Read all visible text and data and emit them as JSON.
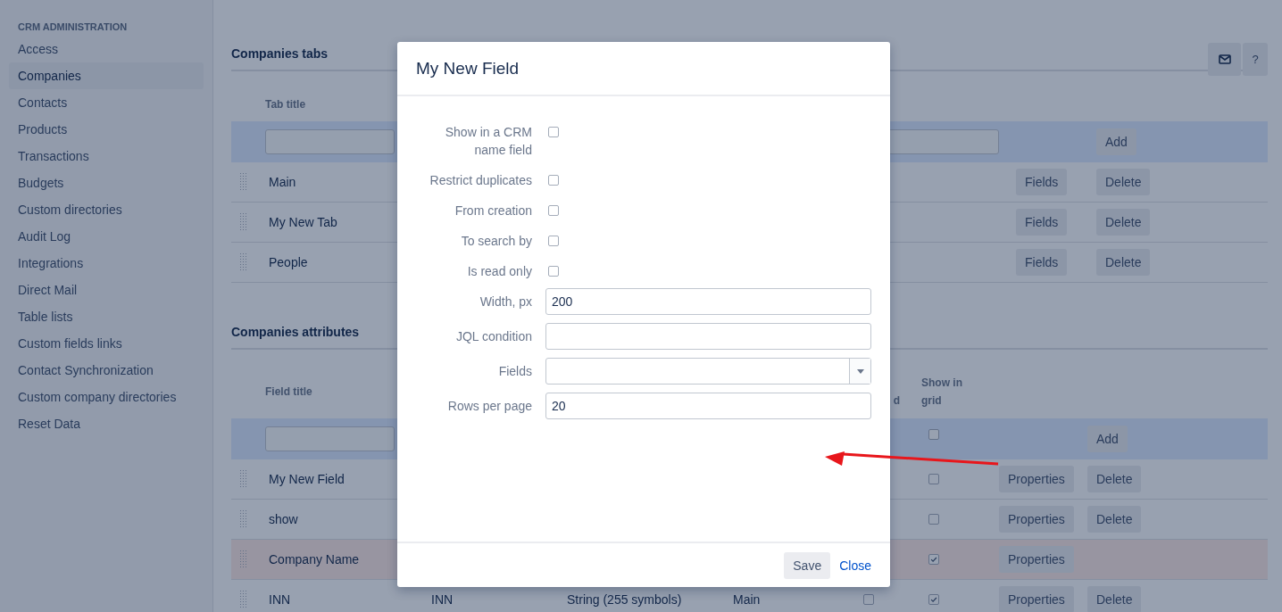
{
  "sidebar": {
    "heading": "CRM ADMINISTRATION",
    "items": [
      {
        "label": "Access",
        "selected": false
      },
      {
        "label": "Companies",
        "selected": true
      },
      {
        "label": "Contacts",
        "selected": false
      },
      {
        "label": "Products",
        "selected": false
      },
      {
        "label": "Transactions",
        "selected": false
      },
      {
        "label": "Budgets",
        "selected": false
      },
      {
        "label": "Custom directories",
        "selected": false
      },
      {
        "label": "Audit Log",
        "selected": false
      },
      {
        "label": "Integrations",
        "selected": false
      },
      {
        "label": "Direct Mail",
        "selected": false
      },
      {
        "label": "Table lists",
        "selected": false
      },
      {
        "label": "Custom fields links",
        "selected": false
      },
      {
        "label": "Contact Synchronization",
        "selected": false
      },
      {
        "label": "Custom company directories",
        "selected": false
      },
      {
        "label": "Reset Data",
        "selected": false
      }
    ]
  },
  "header_buttons": [
    {
      "kind": "mail"
    },
    {
      "kind": "text",
      "label": "?"
    }
  ],
  "tabs_section": {
    "title": "Companies tabs",
    "columns": [
      "Tab title"
    ],
    "add_button": "Add",
    "rows": [
      {
        "title": "Main",
        "buttons": [
          "Fields",
          "Delete"
        ]
      },
      {
        "title": "My New Tab",
        "buttons": [
          "Fields",
          "Delete"
        ]
      },
      {
        "title": "People",
        "buttons": [
          "Fields",
          "Delete"
        ]
      }
    ]
  },
  "attributes_section": {
    "title": "Companies attributes",
    "columns": {
      "field_title": "Field title",
      "column_6": "d",
      "show_in_grid": "Show in grid"
    },
    "filter": {
      "show_in_grid_checked": false,
      "add_button": "Add"
    },
    "rows": [
      {
        "title": "My New Field",
        "highlighted": false,
        "show_in_grid": false,
        "buttons": [
          "Properties",
          "Delete"
        ]
      },
      {
        "title": "show",
        "highlighted": false,
        "show_in_grid": false,
        "buttons": [
          "Properties",
          "Delete"
        ]
      },
      {
        "title": "Company Name",
        "highlighted": true,
        "show_in_grid": true,
        "buttons": [
          "Properties"
        ]
      },
      {
        "title": "INN",
        "column_2": "INN",
        "column_3": "String (255 symbols)",
        "column_4": "Main",
        "column_6_checked": false,
        "highlighted": false,
        "show_in_grid": true,
        "buttons": [
          "Properties",
          "Delete"
        ]
      }
    ]
  },
  "modal": {
    "title": "My New Field",
    "fields": [
      {
        "kind": "checkbox",
        "label": "Show in a CRM name field",
        "checked": false
      },
      {
        "kind": "checkbox",
        "label": "Restrict duplicates",
        "checked": false
      },
      {
        "kind": "checkbox",
        "label": "From creation",
        "checked": false
      },
      {
        "kind": "checkbox",
        "label": "To search by",
        "checked": false
      },
      {
        "kind": "checkbox",
        "label": "Is read only",
        "checked": false
      },
      {
        "kind": "text",
        "label": "Width, px",
        "value": "200"
      },
      {
        "kind": "text",
        "label": "JQL condition"
      },
      {
        "kind": "select",
        "label": "Fields"
      },
      {
        "kind": "text",
        "label": "Rows per page",
        "value": "20"
      }
    ],
    "save_button": "Save",
    "close_link": "Close"
  },
  "annotation": {
    "kind": "arrow"
  }
}
